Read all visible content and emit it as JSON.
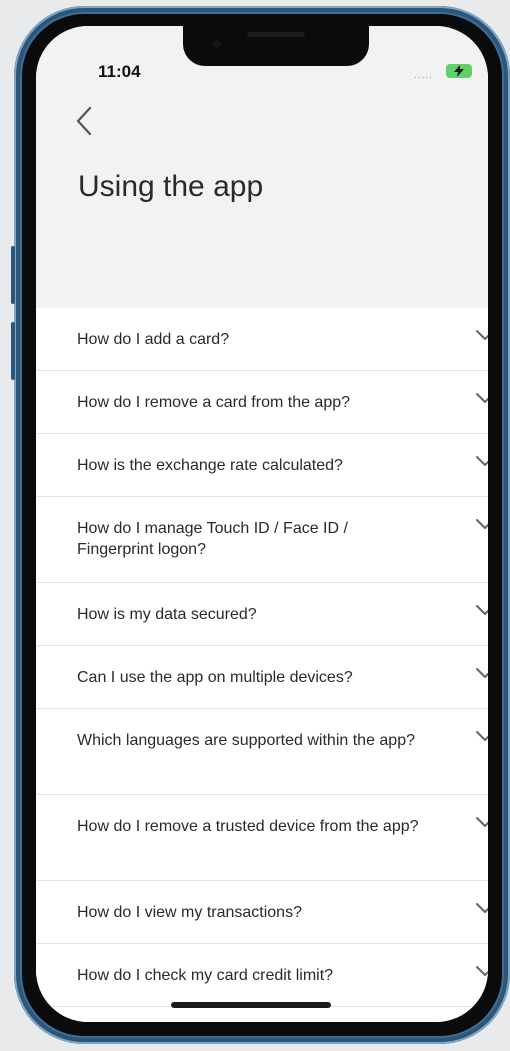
{
  "status_bar": {
    "time": "11:04",
    "signal": "....."
  },
  "header": {
    "back_icon": "chevron-left-icon",
    "title": "Using the app"
  },
  "faq": {
    "expand_icon": "chevron-down-icon",
    "items": [
      {
        "question": "How do I add a card?"
      },
      {
        "question": "How do I remove a card from the app?"
      },
      {
        "question": "How is the exchange rate calculated?"
      },
      {
        "question": "How do I manage Touch ID / Face ID / Fingerprint logon?"
      },
      {
        "question": "How is my data secured?"
      },
      {
        "question": "Can I use the app on multiple devices?"
      },
      {
        "question": "Which languages are supported within the app?"
      },
      {
        "question": "How do I remove a trusted device from the app?"
      },
      {
        "question": "How do I view my transactions?"
      },
      {
        "question": "How do I check my card credit limit?"
      }
    ]
  },
  "colors": {
    "frame": "#3d6f96",
    "header_bg": "#f2f2f3",
    "battery": "#5fd06a",
    "text": "#2a2a2a"
  }
}
